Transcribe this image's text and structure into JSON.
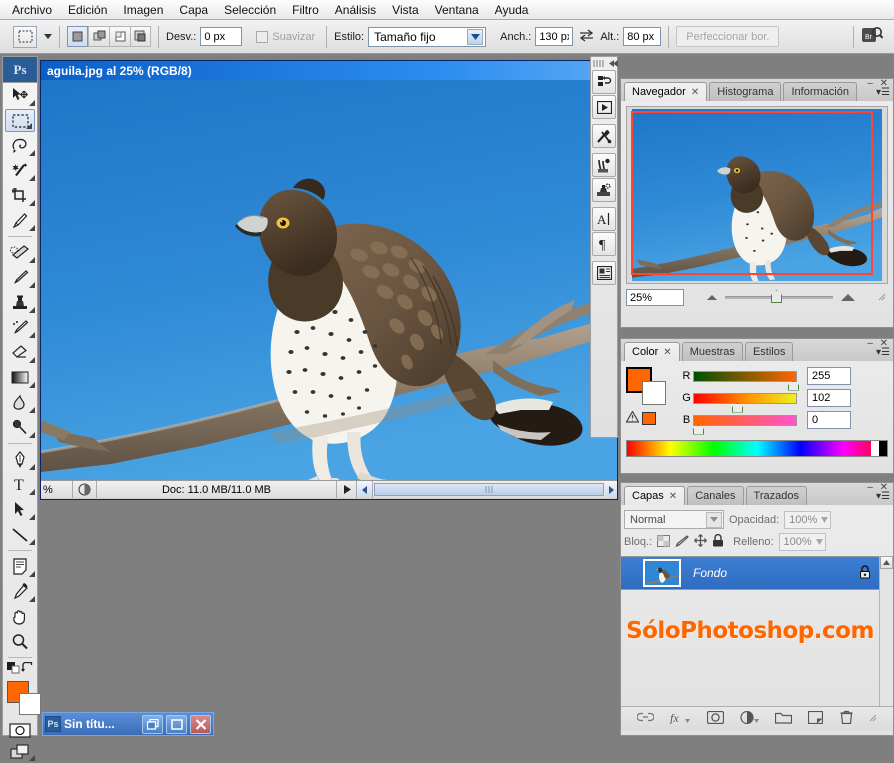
{
  "menubar": {
    "items": [
      "Archivo",
      "Edición",
      "Imagen",
      "Capa",
      "Selección",
      "Filtro",
      "Análisis",
      "Vista",
      "Ventana",
      "Ayuda"
    ]
  },
  "options_bar": {
    "tool_icon": "marquee-icon",
    "desv_label": "Desv.:",
    "desv_value": "0 px",
    "suavizar_label": "Suavizar",
    "estilo_label": "Estilo:",
    "estilo_value": "Tamaño fijo",
    "anch_label": "Anch.:",
    "anch_value": "130 px",
    "swap_icon": "swap-arrows-icon",
    "alt_label": "Alt.:",
    "alt_value": "80 px",
    "refine_button": "Perfeccionar bor.",
    "bridge_icon": "bridge-icon",
    "bool_modes": [
      "new-selection",
      "add-to-selection",
      "subtract-from-selection",
      "intersect-selection"
    ]
  },
  "toolbox": {
    "logo": "Ps",
    "tools": [
      {
        "name": "move-tool",
        "selected": false
      },
      {
        "name": "rectangular-marquee-tool",
        "selected": true
      },
      {
        "name": "lasso-tool",
        "selected": false
      },
      {
        "name": "magic-wand-tool",
        "selected": false
      },
      {
        "name": "crop-tool",
        "selected": false
      },
      {
        "name": "slice-tool",
        "selected": false
      },
      {
        "name": "healing-brush-tool",
        "selected": false
      },
      {
        "name": "brush-tool",
        "selected": false
      },
      {
        "name": "clone-stamp-tool",
        "selected": false
      },
      {
        "name": "history-brush-tool",
        "selected": false
      },
      {
        "name": "eraser-tool",
        "selected": false
      },
      {
        "name": "gradient-tool",
        "selected": false
      },
      {
        "name": "blur-tool",
        "selected": false
      },
      {
        "name": "dodge-tool",
        "selected": false
      },
      {
        "name": "pen-tool",
        "selected": false
      },
      {
        "name": "type-tool",
        "selected": false
      },
      {
        "name": "path-selection-tool",
        "selected": false
      },
      {
        "name": "line-tool",
        "selected": false
      },
      {
        "name": "notes-tool",
        "selected": false
      },
      {
        "name": "eyedropper-tool",
        "selected": false
      },
      {
        "name": "hand-tool",
        "selected": false
      },
      {
        "name": "zoom-tool",
        "selected": false
      }
    ],
    "foreground_color": "#FF6600",
    "background_color": "#FFFFFF",
    "quick_mask": "quick-mask-icon",
    "screen_mode": "screen-mode-icon"
  },
  "document": {
    "title": "aguila.jpg al 25% (RGB/8)",
    "minimize_icon": "minimize-icon",
    "status": "Doc: 11.0 MB/11.0 MB",
    "zoom_display": "%"
  },
  "dock_strip": {
    "buttons": [
      "history-icon",
      "actions-icon",
      "tool-presets-icon",
      "brushes-icon",
      "clone-source-icon",
      "character-icon",
      "paragraph-icon",
      "layer-comps-icon"
    ]
  },
  "navigator_panel": {
    "tabs": [
      {
        "label": "Navegador",
        "active": true,
        "closable": true
      },
      {
        "label": "Histograma",
        "active": false,
        "closable": false
      },
      {
        "label": "Información",
        "active": false,
        "closable": false
      }
    ],
    "zoom_value": "25%",
    "zoom_out_icon": "small-mountain-icon",
    "zoom_in_icon": "large-mountain-icon"
  },
  "color_panel": {
    "tabs": [
      {
        "label": "Color",
        "active": true,
        "closable": true
      },
      {
        "label": "Muestras",
        "active": false,
        "closable": false
      },
      {
        "label": "Estilos",
        "active": false,
        "closable": false
      }
    ],
    "warning_icon": "out-of-gamut-warning-icon",
    "channels": [
      {
        "label": "R",
        "value": "255"
      },
      {
        "label": "G",
        "value": "102"
      },
      {
        "label": "B",
        "value": "0"
      }
    ],
    "foreground_color": "#FF6600",
    "background_color": "#FFFFFF"
  },
  "layers_panel": {
    "tabs": [
      {
        "label": "Capas",
        "active": true,
        "closable": true
      },
      {
        "label": "Canales",
        "active": false,
        "closable": false
      },
      {
        "label": "Trazados",
        "active": false,
        "closable": false
      }
    ],
    "blend_mode": "Normal",
    "opacity_label": "Opacidad:",
    "opacity_value": "100%",
    "lock_label": "Bloq.:",
    "lock_icons": [
      "lock-transparent-pixels-icon",
      "lock-image-pixels-icon",
      "lock-position-icon",
      "lock-all-icon"
    ],
    "fill_label": "Relleno:",
    "fill_value": "100%",
    "layers": [
      {
        "name": "Fondo",
        "visible": true,
        "locked": true,
        "selected": true,
        "visibility_icon": "eye-icon",
        "lock_icon": "padlock-icon"
      }
    ],
    "watermark": "SóloPhotoshop.com",
    "footer_icons": [
      "link-layers-icon",
      "layer-style-fx-icon",
      "layer-mask-icon",
      "adjustment-layer-icon",
      "new-group-icon",
      "new-layer-icon",
      "delete-layer-icon"
    ]
  },
  "taskbar": {
    "app_icon": "photoshop-icon",
    "window_title": "Sin títu...",
    "restore_icon": "restore-icon",
    "maximize_icon": "maximize-icon",
    "close_icon": "close-icon"
  },
  "colors": {
    "accent": "#FF6600",
    "titlebar": "#2d8ef0",
    "selection_blue": "#3c7fd4",
    "navigator_view_rect": "#ff4433",
    "canvas_sky": "#2f86d4"
  }
}
